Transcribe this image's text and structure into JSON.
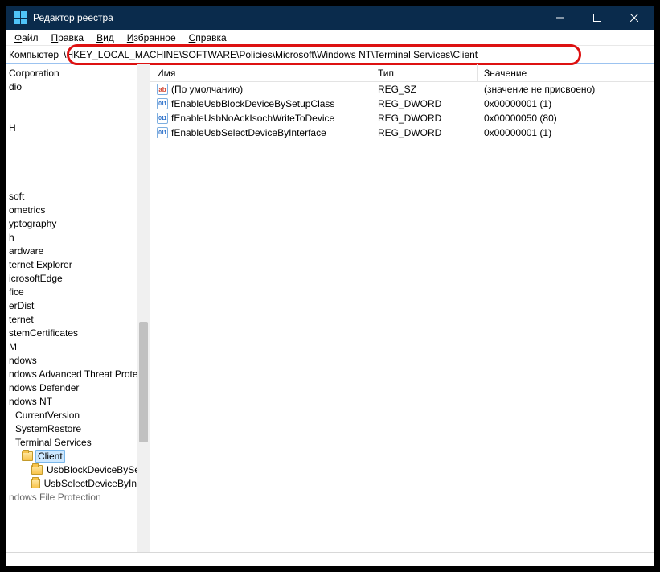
{
  "window": {
    "title": "Редактор реестра"
  },
  "menu": {
    "file": "Файл",
    "edit": "Правка",
    "view": "Вид",
    "favorites": "Избранное",
    "help": "Справка"
  },
  "address": {
    "label": "Компьютер",
    "path": "\\HKEY_LOCAL_MACHINE\\SOFTWARE\\Policies\\Microsoft\\Windows NT\\Terminal Services\\Client"
  },
  "tree": [
    {
      "label": "Corporation",
      "indent": 0
    },
    {
      "label": "dio",
      "indent": 0
    },
    {
      "label": "",
      "indent": 0,
      "blank": true
    },
    {
      "label": "",
      "indent": 0,
      "blank": true
    },
    {
      "label": "H",
      "indent": 0
    },
    {
      "label": "",
      "indent": 0,
      "blank": true
    },
    {
      "label": "",
      "indent": 0,
      "blank": true
    },
    {
      "label": "",
      "indent": 0,
      "blank": true
    },
    {
      "label": "",
      "indent": 0,
      "blank": true
    },
    {
      "label": "soft",
      "indent": 0
    },
    {
      "label": "ometrics",
      "indent": 0
    },
    {
      "label": "yptography",
      "indent": 0
    },
    {
      "label": "h",
      "indent": 0
    },
    {
      "label": "ardware",
      "indent": 0
    },
    {
      "label": "ternet Explorer",
      "indent": 0
    },
    {
      "label": "icrosoftEdge",
      "indent": 0
    },
    {
      "label": "fice",
      "indent": 0
    },
    {
      "label": "erDist",
      "indent": 0
    },
    {
      "label": "ternet",
      "indent": 0
    },
    {
      "label": "stemCertificates",
      "indent": 0
    },
    {
      "label": "M",
      "indent": 0
    },
    {
      "label": "ndows",
      "indent": 0
    },
    {
      "label": "ndows Advanced Threat Prote",
      "indent": 0
    },
    {
      "label": "ndows Defender",
      "indent": 0
    },
    {
      "label": "ndows NT",
      "indent": 0
    },
    {
      "label": "CurrentVersion",
      "indent": 8
    },
    {
      "label": "SystemRestore",
      "indent": 8
    },
    {
      "label": "Terminal Services",
      "indent": 8
    },
    {
      "label": "Client",
      "indent": 18,
      "selected": true,
      "folder": true
    },
    {
      "label": "UsbBlockDeviceBySetu",
      "indent": 30,
      "folder": true
    },
    {
      "label": "UsbSelectDeviceByInter",
      "indent": 30,
      "folder": true
    },
    {
      "label": "ndows File Protection",
      "indent": 0,
      "cut": true
    }
  ],
  "columns": {
    "name": "Имя",
    "type": "Тип",
    "value": "Значение"
  },
  "values": [
    {
      "icon": "str",
      "name": "(По умолчанию)",
      "type": "REG_SZ",
      "value": "(значение не присвоено)"
    },
    {
      "icon": "bin",
      "name": "fEnableUsbBlockDeviceBySetupClass",
      "type": "REG_DWORD",
      "value": "0x00000001 (1)"
    },
    {
      "icon": "bin",
      "name": "fEnableUsbNoAckIsochWriteToDevice",
      "type": "REG_DWORD",
      "value": "0x00000050 (80)"
    },
    {
      "icon": "bin",
      "name": "fEnableUsbSelectDeviceByInterface",
      "type": "REG_DWORD",
      "value": "0x00000001 (1)"
    }
  ]
}
